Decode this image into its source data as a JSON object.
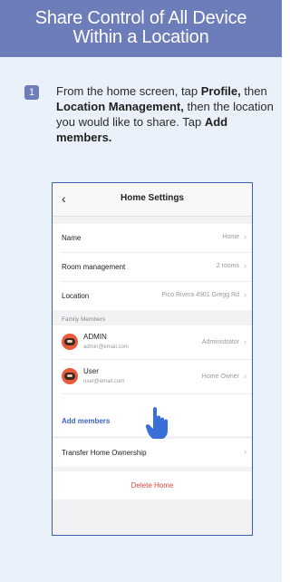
{
  "header": {
    "title_line1": "Share Control of All Device",
    "title_line2": "Within a Location"
  },
  "step": {
    "number": "1",
    "text_parts": [
      "From the home screen, tap ",
      "Profile,",
      " then ",
      "Location Management,",
      " then the location you would like to share. Tap ",
      "Add members."
    ]
  },
  "phone": {
    "title": "Home Settings",
    "rows": [
      {
        "label": "Name",
        "value": "Home"
      },
      {
        "label": "Room management",
        "value": "2 rooms"
      },
      {
        "label": "Location",
        "value": "Pico Rivera 4901 Gregg Rd"
      }
    ],
    "section_label": "Family Members",
    "members": [
      {
        "name": "ADMIN",
        "email": "admin@email.com",
        "role": "Administrator"
      },
      {
        "name": "User",
        "email": "user@email.com",
        "role": "Home Owner"
      }
    ],
    "add_members": "Add members",
    "transfer": "Transfer Home Ownership",
    "delete": "Delete Home"
  },
  "colors": {
    "header_bg": "#6c7db9",
    "panel_bg": "#eaf1fa",
    "link": "#3d63c4",
    "delete": "#e0463a",
    "hand": "#3b6fd8"
  }
}
